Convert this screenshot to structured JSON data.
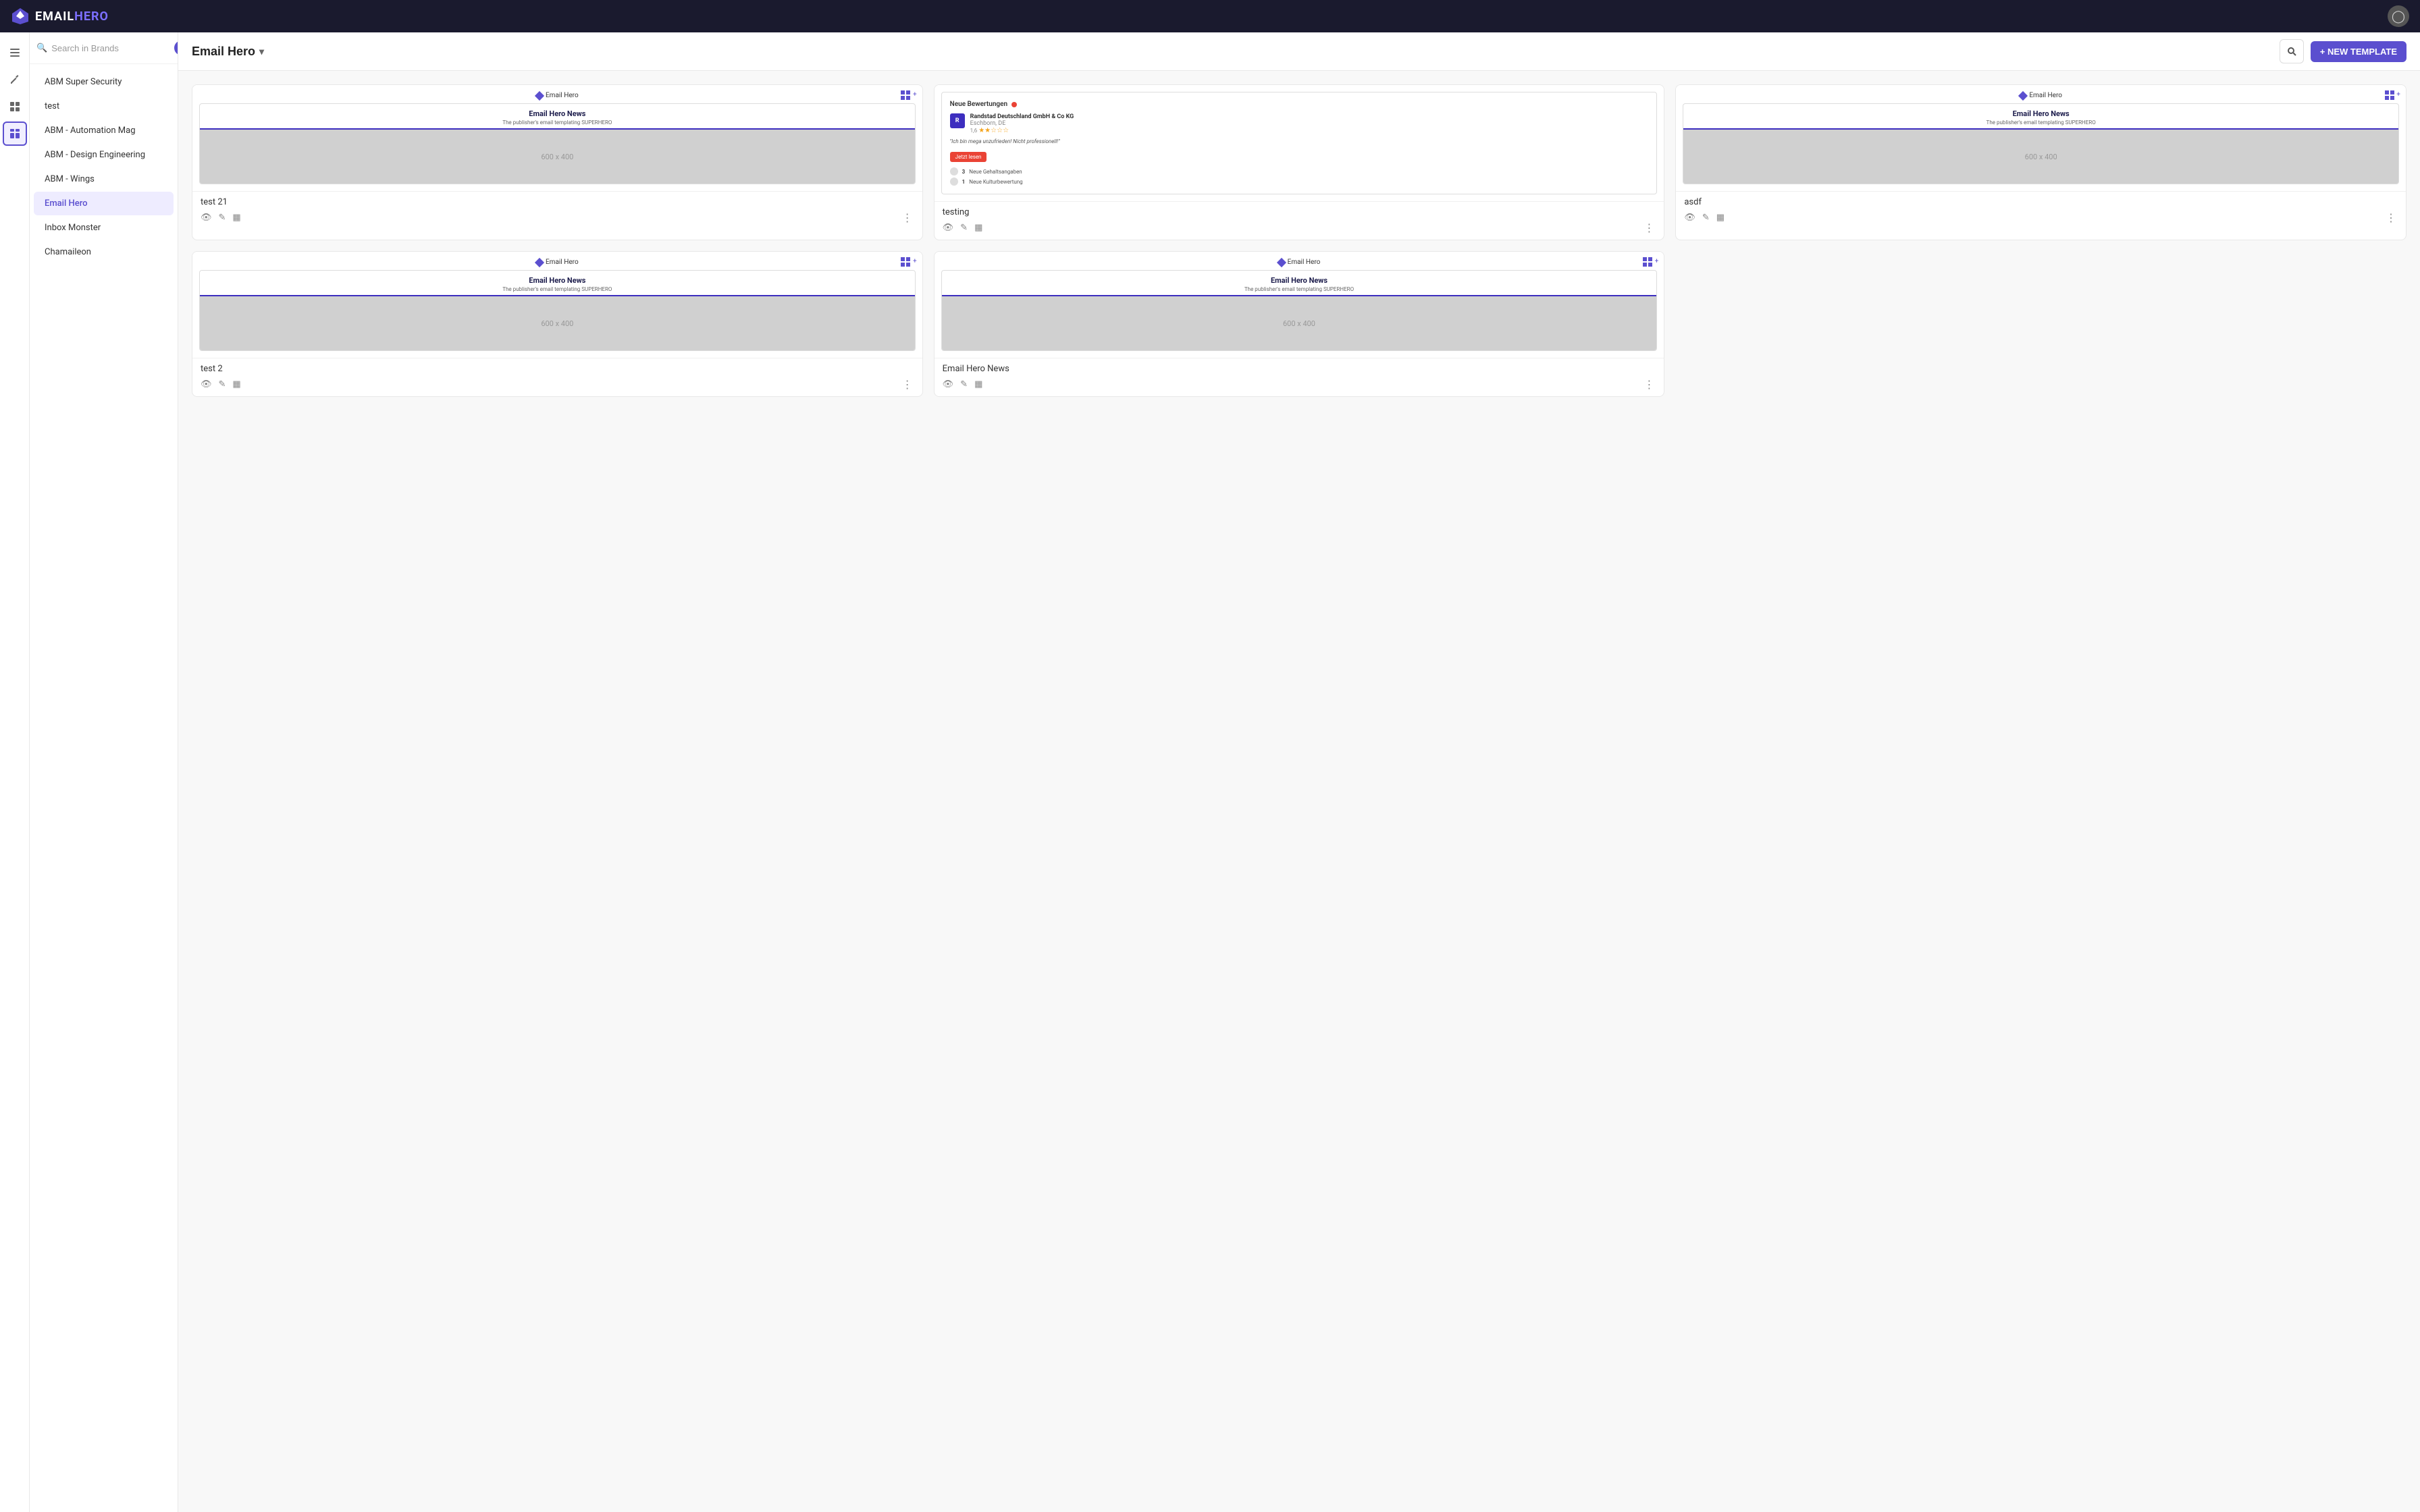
{
  "app": {
    "name_email": "EMAIL",
    "name_hero": "HERO"
  },
  "topnav": {
    "logo_email": "EMAIL",
    "logo_hero": "HERO"
  },
  "icon_sidebar": {
    "items": [
      {
        "icon": "☰",
        "label": "menu-icon",
        "active": false
      },
      {
        "icon": "✂",
        "label": "tools-icon",
        "active": false
      },
      {
        "icon": "⊞",
        "label": "grid-icon",
        "active": false
      },
      {
        "icon": "▦",
        "label": "templates-icon",
        "active": true
      }
    ]
  },
  "brands_sidebar": {
    "search_placeholder": "Search in Brands",
    "brands": [
      {
        "label": "ABM Super Security",
        "active": false
      },
      {
        "label": "test",
        "active": false
      },
      {
        "label": "ABM - Automation Mag",
        "active": false
      },
      {
        "label": "ABM - Design Engineering",
        "active": false
      },
      {
        "label": "ABM - Wings",
        "active": false
      },
      {
        "label": "Email Hero",
        "active": true
      },
      {
        "label": "Inbox Monster",
        "active": false
      },
      {
        "label": "Chamaileon",
        "active": false
      }
    ]
  },
  "content": {
    "selected_brand": "Email Hero",
    "new_template_label": "+ NEW TEMPLATE",
    "templates": [
      {
        "id": "test21",
        "brand_badge": "Email Hero",
        "title": "Email Hero News",
        "subtitle": "The publisher's email templating SUPERHERO",
        "image_label": "600 x 400",
        "name": "test 21",
        "type": "email"
      },
      {
        "id": "testing",
        "brand_badge": null,
        "title": null,
        "subtitle": null,
        "image_label": null,
        "name": "testing",
        "type": "review"
      },
      {
        "id": "asdf",
        "brand_badge": "Email Hero",
        "title": "Email Hero News",
        "subtitle": "The publisher's email templating SUPERHERO",
        "image_label": "600 x 400",
        "name": "asdf",
        "type": "email"
      },
      {
        "id": "test2",
        "brand_badge": "Email Hero",
        "title": "Email Hero News",
        "subtitle": "The publisher's email templating SUPERHERO",
        "image_label": "600 x 400",
        "name": "test 2",
        "type": "email"
      },
      {
        "id": "emailheronews",
        "brand_badge": "Email Hero",
        "title": "Email Hero News",
        "subtitle": "The publisher's email templating SUPERHERO",
        "image_label": "600 x 400",
        "name": "Email Hero News",
        "type": "email"
      }
    ],
    "review_card": {
      "header": "Neue Bewertungen",
      "company_name": "Randstad Deutschland GmbH & Co KG",
      "company_location": "Eschborn, DE",
      "rating": "1,6",
      "quote": "\"Ich bin mega unzufrieden! Nicht professionell!\"",
      "cta": "Jetzt lesen",
      "stat1_num": "3",
      "stat1_label": "Neue Gehaltsangaben",
      "stat2_num": "1",
      "stat2_label": "Neue Kulturbewertung"
    }
  }
}
